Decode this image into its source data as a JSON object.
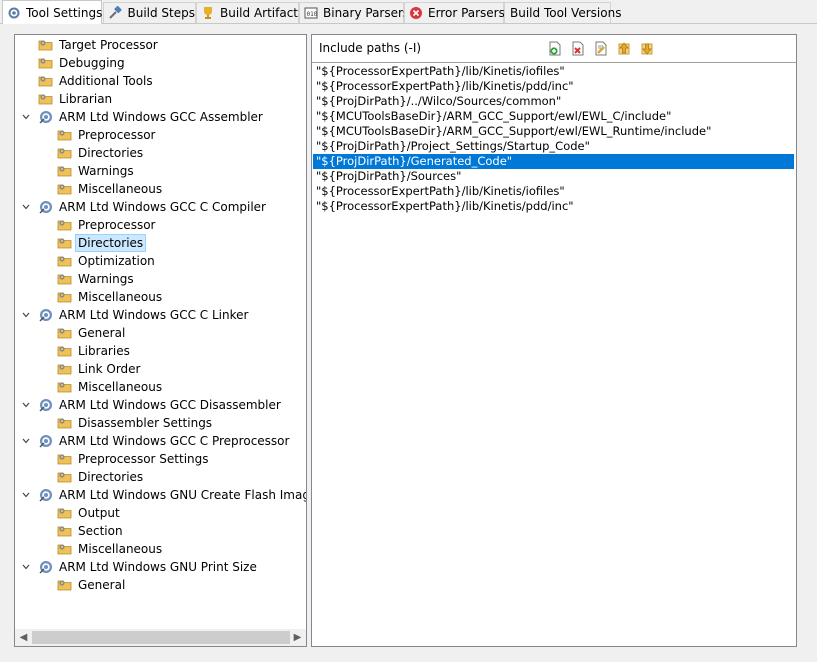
{
  "tabs": [
    {
      "label": "Tool Settings",
      "icon": "gear-icon",
      "active": true
    },
    {
      "label": "Build Steps",
      "icon": "build-steps-icon",
      "active": false
    },
    {
      "label": "Build Artifact",
      "icon": "trophy-icon",
      "active": false
    },
    {
      "label": "Binary Parsers",
      "icon": "binary-icon",
      "active": false
    },
    {
      "label": "Error Parsers",
      "icon": "error-icon",
      "active": false
    },
    {
      "label": "Build Tool Versions",
      "icon": "",
      "active": false
    }
  ],
  "tree": [
    {
      "label": "Target Processor",
      "level": 1,
      "icon": "folder-gear-icon"
    },
    {
      "label": "Debugging",
      "level": 1,
      "icon": "folder-gear-icon"
    },
    {
      "label": "Additional Tools",
      "level": 1,
      "icon": "folder-gear-icon"
    },
    {
      "label": "Librarian",
      "level": 1,
      "icon": "folder-gear-icon"
    },
    {
      "label": "ARM Ltd Windows GCC Assembler",
      "level": 1,
      "icon": "tool-gear-icon",
      "expanded": true
    },
    {
      "label": "Preprocessor",
      "level": 2,
      "icon": "folder-gear-icon"
    },
    {
      "label": "Directories",
      "level": 2,
      "icon": "folder-gear-icon"
    },
    {
      "label": "Warnings",
      "level": 2,
      "icon": "folder-gear-icon"
    },
    {
      "label": "Miscellaneous",
      "level": 2,
      "icon": "folder-gear-icon"
    },
    {
      "label": "ARM Ltd Windows GCC C Compiler",
      "level": 1,
      "icon": "tool-gear-icon",
      "expanded": true
    },
    {
      "label": "Preprocessor",
      "level": 2,
      "icon": "folder-gear-icon"
    },
    {
      "label": "Directories",
      "level": 2,
      "icon": "folder-gear-icon",
      "selected": true
    },
    {
      "label": "Optimization",
      "level": 2,
      "icon": "folder-gear-icon"
    },
    {
      "label": "Warnings",
      "level": 2,
      "icon": "folder-gear-icon"
    },
    {
      "label": "Miscellaneous",
      "level": 2,
      "icon": "folder-gear-icon"
    },
    {
      "label": "ARM Ltd Windows GCC C Linker",
      "level": 1,
      "icon": "tool-gear-icon",
      "expanded": true
    },
    {
      "label": "General",
      "level": 2,
      "icon": "folder-gear-icon"
    },
    {
      "label": "Libraries",
      "level": 2,
      "icon": "folder-gear-icon"
    },
    {
      "label": "Link Order",
      "level": 2,
      "icon": "folder-gear-icon"
    },
    {
      "label": "Miscellaneous",
      "level": 2,
      "icon": "folder-gear-icon"
    },
    {
      "label": "ARM Ltd Windows GCC Disassembler",
      "level": 1,
      "icon": "tool-gear-icon",
      "expanded": true
    },
    {
      "label": "Disassembler Settings",
      "level": 2,
      "icon": "folder-gear-icon"
    },
    {
      "label": "ARM Ltd Windows GCC C Preprocessor",
      "level": 1,
      "icon": "tool-gear-icon",
      "expanded": true
    },
    {
      "label": "Preprocessor Settings",
      "level": 2,
      "icon": "folder-gear-icon"
    },
    {
      "label": "Directories",
      "level": 2,
      "icon": "folder-gear-icon"
    },
    {
      "label": "ARM Ltd Windows GNU Create Flash Image",
      "level": 1,
      "icon": "tool-gear-icon",
      "expanded": true
    },
    {
      "label": "Output",
      "level": 2,
      "icon": "folder-gear-icon"
    },
    {
      "label": "Section",
      "level": 2,
      "icon": "folder-gear-icon"
    },
    {
      "label": "Miscellaneous",
      "level": 2,
      "icon": "folder-gear-icon"
    },
    {
      "label": "ARM Ltd Windows GNU Print Size",
      "level": 1,
      "icon": "tool-gear-icon",
      "expanded": true
    },
    {
      "label": "General",
      "level": 2,
      "icon": "folder-gear-icon"
    }
  ],
  "include_panel": {
    "title": "Include paths (-I)",
    "toolbar": [
      "add-path-icon",
      "delete-path-icon",
      "edit-path-icon",
      "move-up-icon",
      "move-down-icon"
    ],
    "paths": [
      "\"${ProcessorExpertPath}/lib/Kinetis/iofiles\"",
      "\"${ProcessorExpertPath}/lib/Kinetis/pdd/inc\"",
      "\"${ProjDirPath}/../Wilco/Sources/common\"",
      "\"${MCUToolsBaseDir}/ARM_GCC_Support/ewl/EWL_C/include\"",
      "\"${MCUToolsBaseDir}/ARM_GCC_Support/ewl/EWL_Runtime/include\"",
      "\"${ProjDirPath}/Project_Settings/Startup_Code\"",
      "\"${ProjDirPath}/Generated_Code\"",
      "\"${ProjDirPath}/Sources\"",
      "\"${ProcessorExpertPath}/lib/Kinetis/iofiles\"",
      "\"${ProcessorExpertPath}/lib/Kinetis/pdd/inc\""
    ],
    "selected_index": 6
  },
  "colors": {
    "selection": "#0078d7",
    "tree_selection": "#cce8ff",
    "folder": "#e8b341"
  }
}
